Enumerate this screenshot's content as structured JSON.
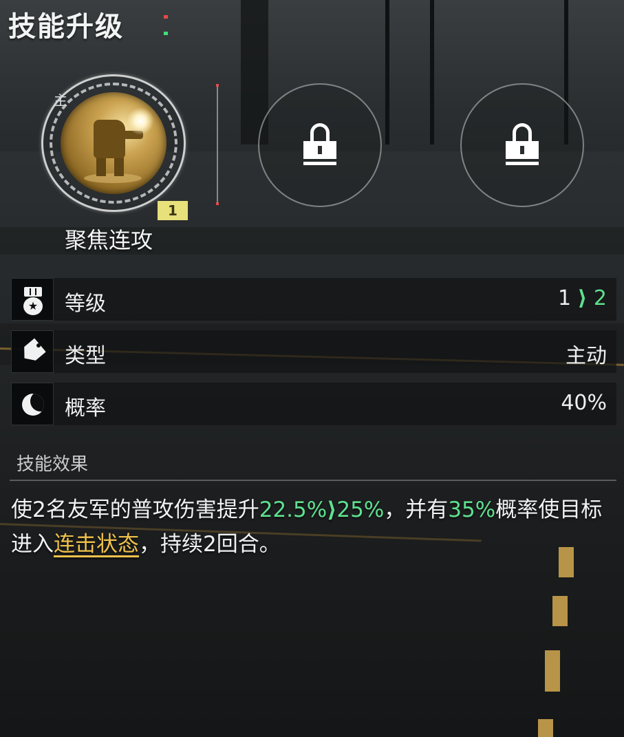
{
  "title": "技能升级",
  "colors": {
    "accent_green": "#5fe08f",
    "link_gold": "#f0c24a",
    "level_badge": "#e8e07a"
  },
  "skill_slots": [
    {
      "state": "active",
      "tag": "主",
      "level_badge": "1",
      "name": "聚焦连攻",
      "icon": "mech-skill-icon"
    },
    {
      "state": "locked",
      "icon": "lock-icon"
    },
    {
      "state": "locked",
      "icon": "lock-icon"
    }
  ],
  "stats": {
    "level": {
      "icon": "medal-icon",
      "label": "等级",
      "from": "1",
      "arrow": "⟩",
      "to": "2"
    },
    "type": {
      "icon": "tag-icon",
      "label": "类型",
      "value": "主动"
    },
    "chance": {
      "icon": "moon-icon",
      "label": "概率",
      "value": "40%"
    }
  },
  "effect": {
    "section_title": "技能效果",
    "part1": "使2名友军的普攻伤害提升",
    "from_value": "22.5%",
    "arrow": "⟩",
    "to_value": "25%",
    "part2": "，并有",
    "chance_value": "35%",
    "part3": "概率使目标进入",
    "status_link": "连击状态",
    "part4": "，持续2回合。"
  }
}
